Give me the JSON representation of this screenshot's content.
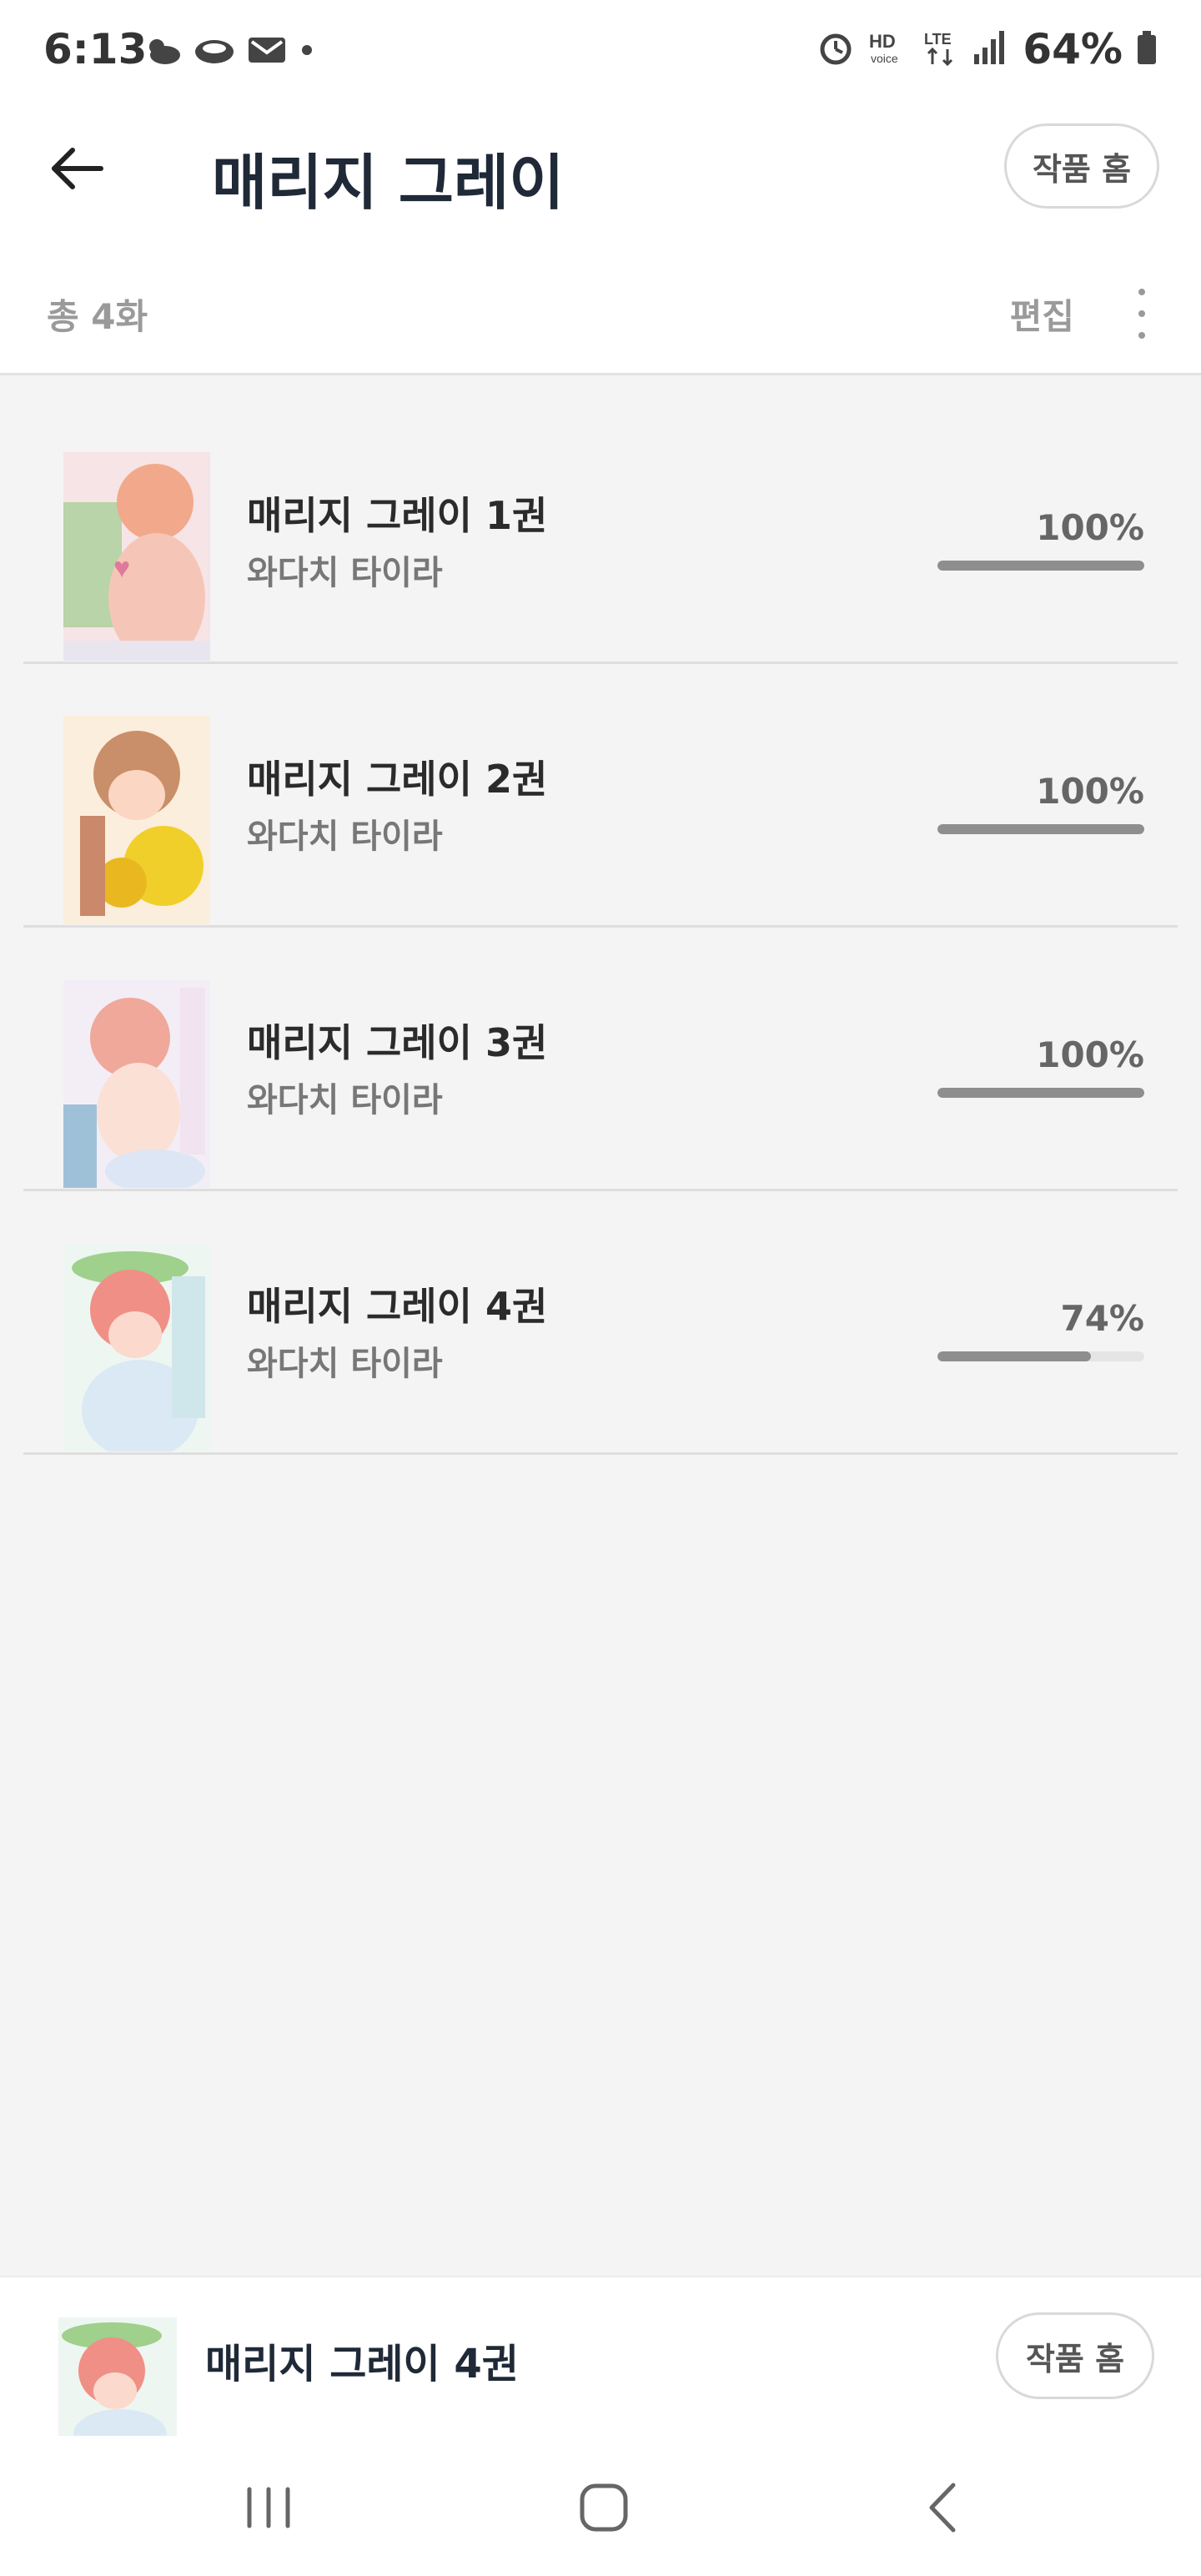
{
  "status_bar": {
    "time": "6:13",
    "battery": "64%",
    "left_icons": [
      "weather-icon",
      "cloud-icon",
      "mail-icon",
      "dot-icon"
    ],
    "right_icons": [
      "alarm-icon",
      "hd-voice-icon",
      "lte-icon",
      "signal-icon",
      "battery-icon"
    ]
  },
  "header": {
    "title": "매리지 그레이",
    "home_button": "작품 홈"
  },
  "subheader": {
    "total": "총 4화",
    "edit": "편집"
  },
  "items": [
    {
      "title": "매리지 그레이 1권",
      "author": "와다치 타이라",
      "progress_label": "100%",
      "progress": 1.0
    },
    {
      "title": "매리지 그레이 2권",
      "author": "와다치 타이라",
      "progress_label": "100%",
      "progress": 1.0
    },
    {
      "title": "매리지 그레이 3권",
      "author": "와다치 타이라",
      "progress_label": "100%",
      "progress": 1.0
    },
    {
      "title": "매리지 그레이 4권",
      "author": "와다치 타이라",
      "progress_label": "74%",
      "progress": 0.74
    }
  ],
  "bottom_panel": {
    "title": "매리지 그레이 4권",
    "home_button": "작품 홈"
  },
  "colors": {
    "accent": "#1f2937",
    "progress_fill": "#8e8e8e",
    "progress_track": "#e5e5e5"
  }
}
